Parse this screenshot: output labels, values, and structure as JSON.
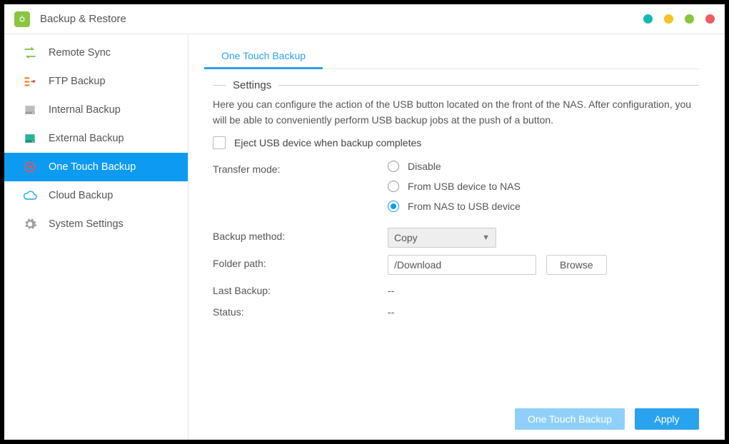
{
  "titlebar": {
    "title": "Backup & Restore",
    "dots": [
      "#15b9b0",
      "#f7c322",
      "#8bc540",
      "#ef5b66"
    ]
  },
  "sidebar": {
    "items": [
      {
        "label": "Remote Sync",
        "active": false
      },
      {
        "label": "FTP Backup",
        "active": false
      },
      {
        "label": "Internal Backup",
        "active": false
      },
      {
        "label": "External Backup",
        "active": false
      },
      {
        "label": "One Touch Backup",
        "active": true
      },
      {
        "label": "Cloud Backup",
        "active": false
      },
      {
        "label": "System Settings",
        "active": false
      }
    ]
  },
  "main": {
    "tab": "One Touch Backup",
    "settings_legend": "Settings",
    "description": "Here you can configure the action of the USB button located on the front of the NAS. After configuration, you will be able to conveniently perform USB backup jobs at the push of a button.",
    "eject_label": "Eject USB device when backup completes",
    "transfer_label": "Transfer mode:",
    "transfer_options": {
      "disable": "Disable",
      "usb_to_nas": "From USB device to NAS",
      "nas_to_usb": "From NAS to USB device"
    },
    "backup_method_label": "Backup method:",
    "backup_method_value": "Copy",
    "folder_label": "Folder path:",
    "folder_value": "/Download",
    "browse_label": "Browse",
    "last_backup_label": "Last Backup:",
    "last_backup_value": "--",
    "status_label": "Status:",
    "status_value": "--"
  },
  "footer": {
    "one_touch": "One Touch Backup",
    "apply": "Apply"
  }
}
